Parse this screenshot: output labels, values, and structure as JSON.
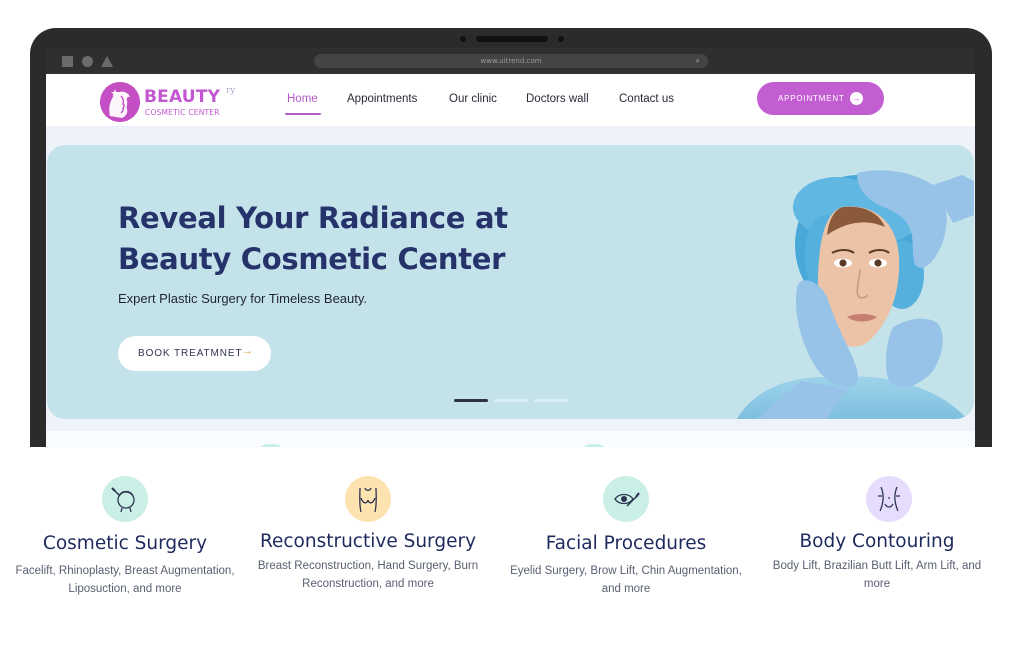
{
  "browser": {
    "url": "www.uitrend.com"
  },
  "brand": {
    "name": "BEAUTY",
    "tagline": "COSMETIC CENTER",
    "ghost_text": "ry",
    "accent_color": "#c25ed1"
  },
  "nav": {
    "items": [
      {
        "label": "Home",
        "active": true
      },
      {
        "label": "Appointments",
        "active": false
      },
      {
        "label": "Our clinic",
        "active": false
      },
      {
        "label": "Doctors wall",
        "active": false
      },
      {
        "label": "Contact us",
        "active": false
      }
    ],
    "cta_label": "APPOINTMENT",
    "cta_icon": "arrow-right-circle-icon"
  },
  "hero": {
    "title": "Reveal Your Radiance at Beauty Cosmetic Center",
    "subtitle": "Expert Plastic Surgery for Timeless Beauty.",
    "button_label": "BOOK TREATMNET",
    "button_icon": "arrow-right-icon",
    "background_color": "#c4e2ea",
    "slider_total": 3,
    "slider_active": 1
  },
  "services": [
    {
      "title": "Cosmetic Surgery",
      "description": "Facelift, Rhinoplasty, Breast Augmentation, Liposuction, and more",
      "icon": "face-injection-icon",
      "icon_bg": "#c9efe6"
    },
    {
      "title": "Reconstructive Surgery",
      "description": "Breast Reconstruction, Hand Surgery, Burn Reconstruction, and more",
      "icon": "torso-icon",
      "icon_bg": "#fde3b0"
    },
    {
      "title": "Facial Procedures",
      "description": "Eyelid Surgery, Brow Lift, Chin Augmentation, and more",
      "icon": "eye-scalpel-icon",
      "icon_bg": "#c9efe6"
    },
    {
      "title": "Body Contouring",
      "description": "Body Lift, Brazilian Butt Lift, Arm Lift, and more",
      "icon": "waist-icon",
      "icon_bg": "#e6dcfb"
    }
  ]
}
